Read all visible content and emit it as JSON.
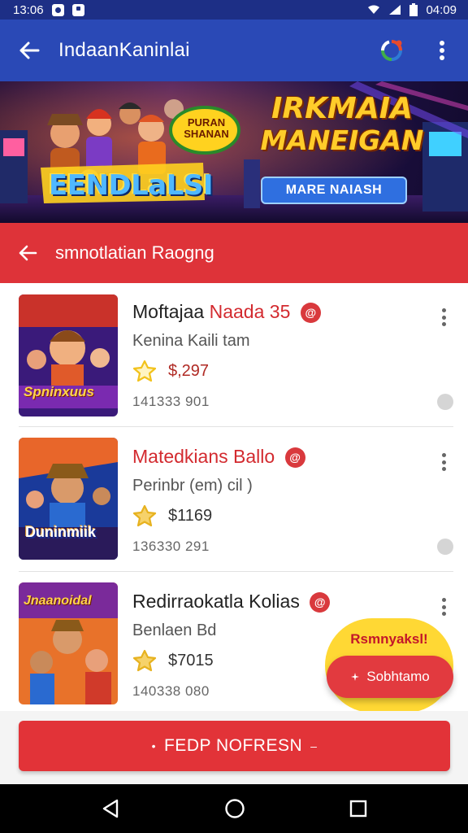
{
  "status_bar": {
    "time_left": "13:06",
    "time_right": "04:09"
  },
  "app_bar": {
    "title": "IndaanKaninlai"
  },
  "banner": {
    "logo_text": "EENDLaLSI",
    "badge_text": "PURAN SHANAN",
    "headline_line1": "IRKMAIA",
    "headline_line2": "MANEIGAN",
    "button_label": "MARE NAIASH"
  },
  "section": {
    "title": "smnotlatian Raogng"
  },
  "items": [
    {
      "title": "Moftajaa",
      "title_accent": "Naada",
      "title_tail": "35",
      "badge": "@",
      "subtitle": "Kenina Kaili    tam",
      "price": "$,297",
      "meta": "141333 901",
      "thumb_text": "Spninxuus",
      "star_color": "#f2c21b"
    },
    {
      "title": "Matedkians Ballo",
      "badge": "@",
      "subtitle": "Perinbr (em) cil          )",
      "price": "$1169",
      "meta": "136330 291",
      "thumb_text": "Duninmiik",
      "star_color": "#e7b21f"
    },
    {
      "title": "Redirraokatla Kolias",
      "badge": "@",
      "subtitle": "Benlaen Bd",
      "price": "$7015",
      "meta": "140338 080",
      "thumb_text": "Jnaanoidal",
      "star_color": "#e7b21f"
    }
  ],
  "floating": {
    "label": "Rsmnyaksl!",
    "button": "Sobhtamo"
  },
  "bottom_cta": {
    "label": "FEDP NOFRESN"
  },
  "icons": {
    "back": "arrow-left-icon",
    "ring": "loading-ring-icon",
    "more": "more-vertical-icon",
    "star": "star-icon",
    "nav_back": "nav-back-icon",
    "nav_home": "nav-home-icon",
    "nav_recent": "nav-recent-icon"
  },
  "colors": {
    "primary": "#2a49b6",
    "status": "#1d2f86",
    "accent_red": "#de3339",
    "cta_red": "#e23338",
    "highlight": "#ffd834"
  }
}
